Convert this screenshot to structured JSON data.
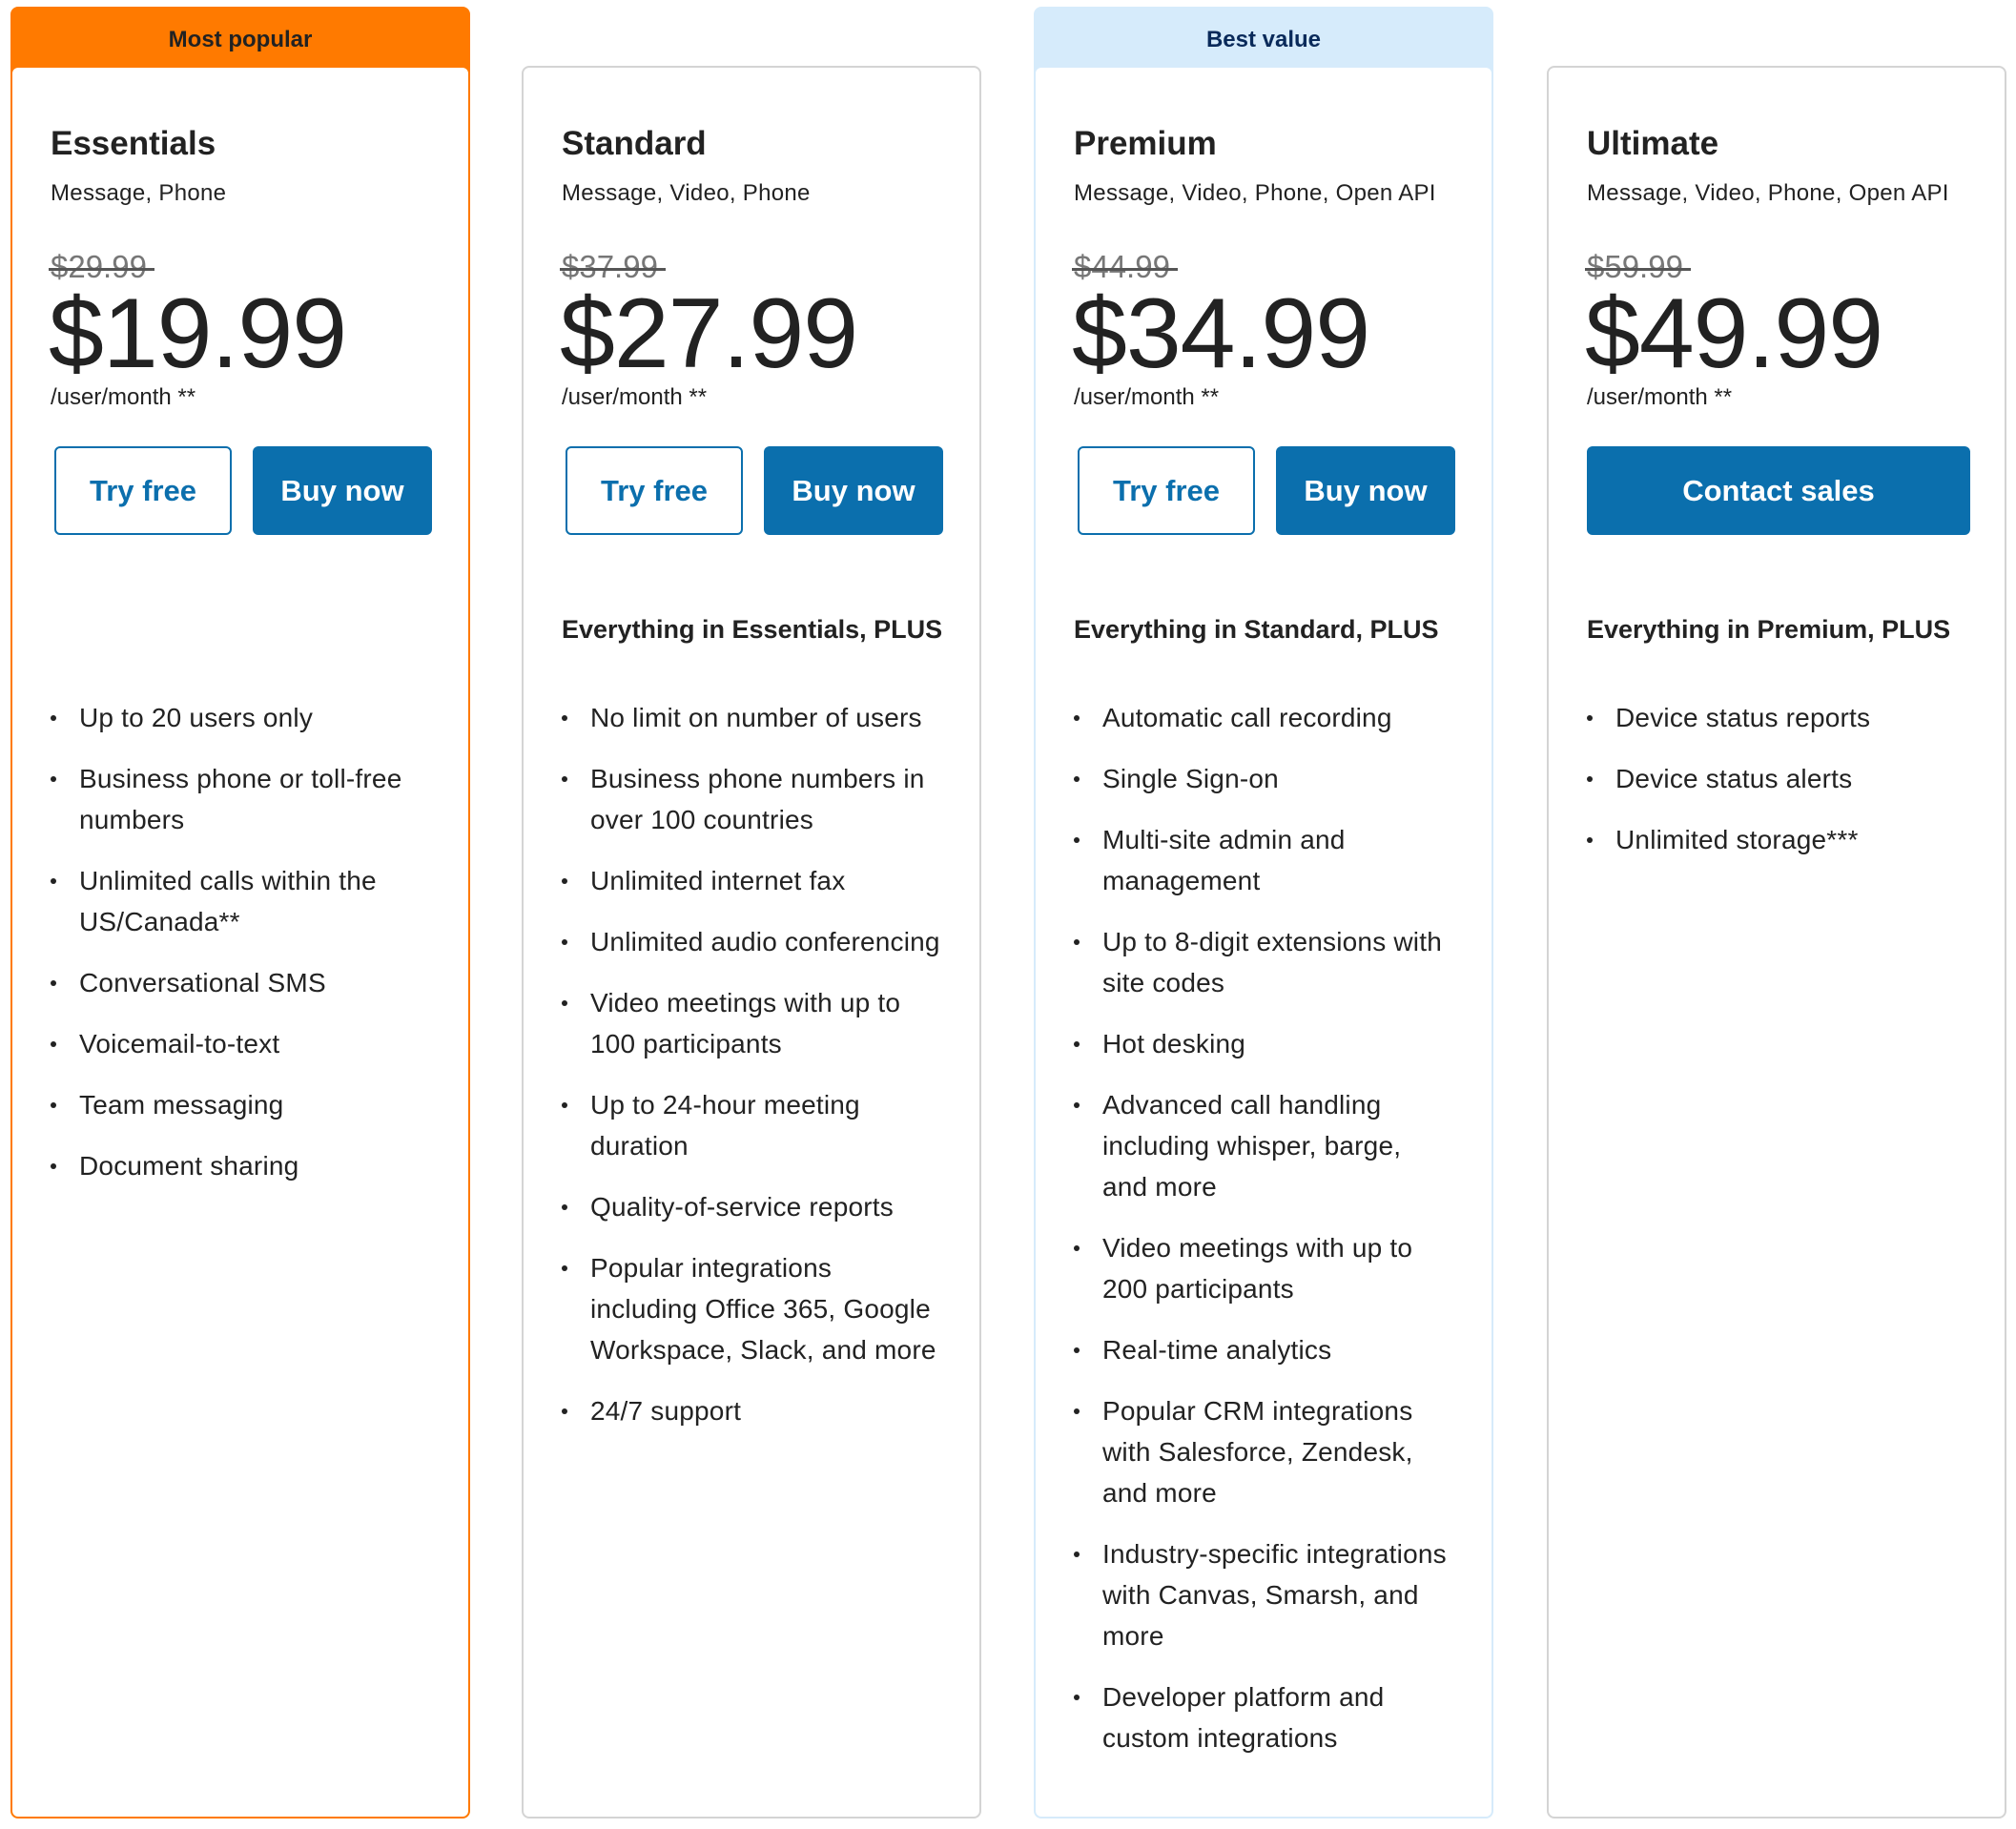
{
  "colors": {
    "brand_blue": "#0b6fad",
    "most_popular_badge": "#ff7a00",
    "best_value_badge": "#d6ebfb",
    "card_border": "#d4d4d4"
  },
  "plans": [
    {
      "badge": "Most popular",
      "name": "Essentials",
      "channels": "Message, Phone",
      "old_price": "$29.99",
      "price": "$19.99",
      "period": "/user/month **",
      "try_label": "Try free",
      "buy_label": "Buy now",
      "plus_heading": "",
      "features": [
        "Up to 20 users only",
        "Business phone or toll-free numbers",
        "Unlimited calls within the US/Canada**",
        "Conversational SMS",
        "Voicemail-to-text",
        "Team messaging",
        "Document sharing"
      ]
    },
    {
      "badge": "",
      "name": "Standard",
      "channels": "Message, Video, Phone",
      "old_price": "$37.99",
      "price": "$27.99",
      "period": "/user/month **",
      "try_label": "Try free",
      "buy_label": "Buy now",
      "plus_heading": "Everything in Essentials, PLUS",
      "features": [
        "No limit on number of users",
        "Business phone numbers in over 100 countries",
        "Unlimited internet fax",
        "Unlimited audio conferencing",
        "Video meetings with up to 100 participants",
        "Up to 24-hour meeting duration",
        "Quality-of-service reports",
        "Popular integrations including Office 365, Google Workspace, Slack, and more",
        "24/7 support"
      ]
    },
    {
      "badge": "Best value",
      "name": "Premium",
      "channels": "Message, Video, Phone, Open API",
      "old_price": "$44.99",
      "price": "$34.99",
      "period": "/user/month **",
      "try_label": "Try free",
      "buy_label": "Buy now",
      "plus_heading": "Everything in Standard, PLUS",
      "features": [
        "Automatic call recording",
        "Single Sign-on",
        "Multi-site admin and management",
        "Up to 8-digit extensions with site codes",
        "Hot desking",
        "Advanced call handling including whisper, barge, and more",
        "Video meetings with up to 200 participants",
        "Real-time analytics",
        "Popular CRM integrations with Salesforce, Zendesk, and more",
        "Industry-specific integrations with Canvas, Smarsh, and more",
        "Developer platform and custom integrations"
      ]
    },
    {
      "badge": "",
      "name": "Ultimate",
      "channels": "Message, Video, Phone, Open API",
      "old_price": "$59.99",
      "price": "$49.99",
      "period": "/user/month **",
      "contact_label": "Contact sales",
      "plus_heading": "Everything in Premium, PLUS",
      "features": [
        "Device status reports",
        "Device status alerts",
        "Unlimited storage***"
      ]
    }
  ]
}
